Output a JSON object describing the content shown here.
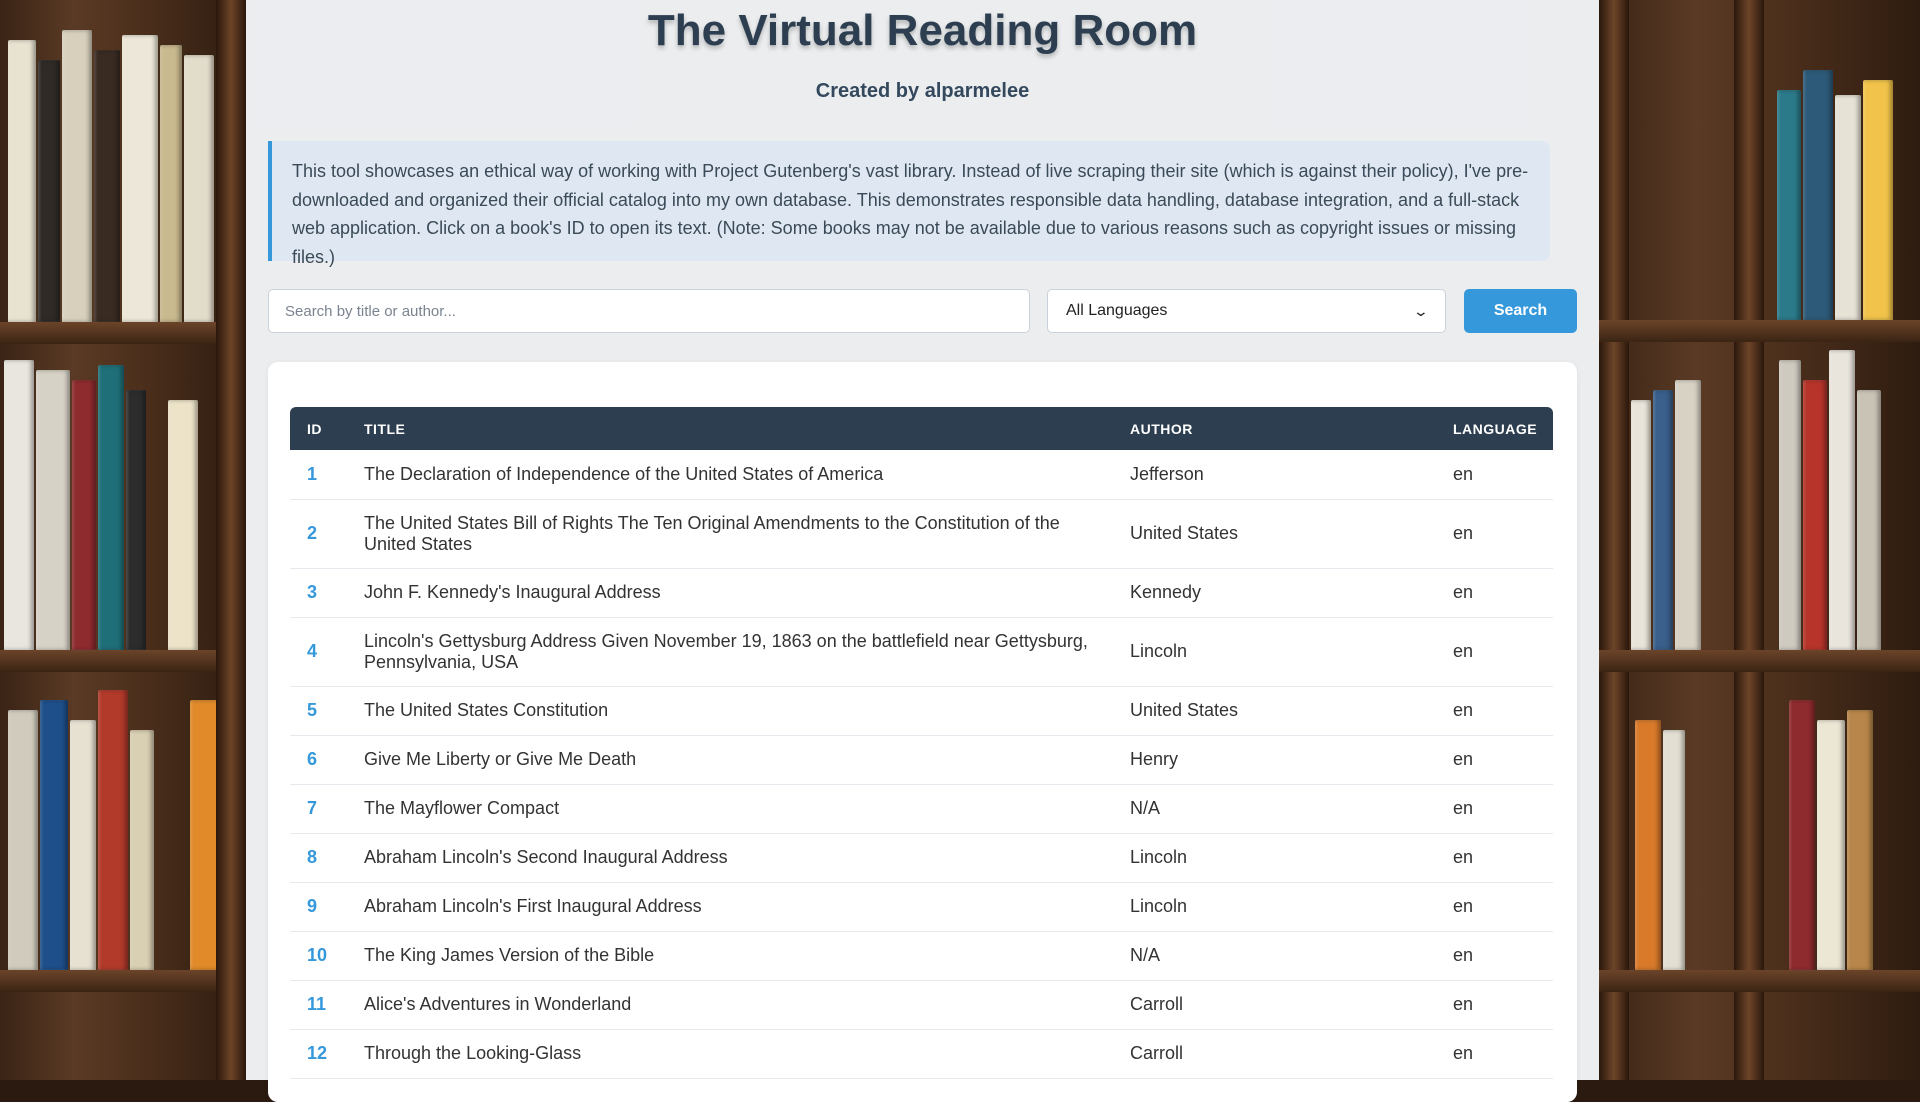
{
  "header": {
    "title": "The Virtual Reading Room",
    "subtitle": "Created by alparmelee"
  },
  "info": {
    "text": "This tool showcases an ethical way of working with Project Gutenberg's vast library. Instead of live scraping their site (which is against their policy), I've pre-downloaded and organized their official catalog into my own database. This demonstrates responsible data handling, database integration, and a full-stack web application. Click on a book's ID to open its text. (Note: Some books may not be available due to various reasons such as copyright issues or missing files.)"
  },
  "search": {
    "placeholder": "Search by title or author...",
    "language_selected": "All Languages",
    "button_label": "Search"
  },
  "table": {
    "columns": {
      "id": "ID",
      "title": "TITLE",
      "author": "AUTHOR",
      "language": "LANGUAGE"
    },
    "rows": [
      {
        "id": "1",
        "title": "The Declaration of Independence of the United States of America",
        "author": "Jefferson",
        "language": "en"
      },
      {
        "id": "2",
        "title": "The United States Bill of Rights The Ten Original Amendments to the Constitution of the United States",
        "author": "United States",
        "language": "en"
      },
      {
        "id": "3",
        "title": "John F. Kennedy's Inaugural Address",
        "author": "Kennedy",
        "language": "en"
      },
      {
        "id": "4",
        "title": "Lincoln's Gettysburg Address Given November 19, 1863 on the battlefield near Gettysburg, Pennsylvania, USA",
        "author": "Lincoln",
        "language": "en"
      },
      {
        "id": "5",
        "title": "The United States Constitution",
        "author": "United States",
        "language": "en"
      },
      {
        "id": "6",
        "title": "Give Me Liberty or Give Me Death",
        "author": "Henry",
        "language": "en"
      },
      {
        "id": "7",
        "title": "The Mayflower Compact",
        "author": "N/A",
        "language": "en"
      },
      {
        "id": "8",
        "title": "Abraham Lincoln's Second Inaugural Address",
        "author": "Lincoln",
        "language": "en"
      },
      {
        "id": "9",
        "title": "Abraham Lincoln's First Inaugural Address",
        "author": "Lincoln",
        "language": "en"
      },
      {
        "id": "10",
        "title": "The King James Version of the Bible",
        "author": "N/A",
        "language": "en"
      },
      {
        "id": "11",
        "title": "Alice's Adventures in Wonderland",
        "author": "Carroll",
        "language": "en"
      },
      {
        "id": "12",
        "title": "Through the Looking-Glass",
        "author": "Carroll",
        "language": "en"
      }
    ]
  },
  "colors": {
    "accent": "#3498db",
    "header_dark": "#2c3e50",
    "info_bg": "#dfe8f2"
  }
}
